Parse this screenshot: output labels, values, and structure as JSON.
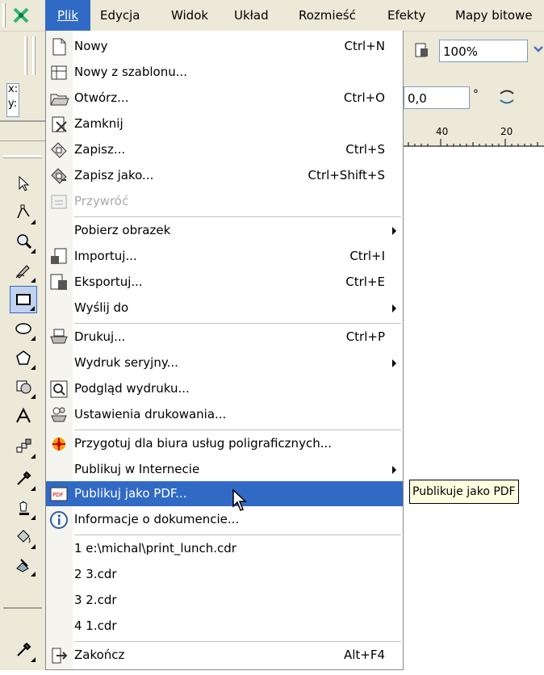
{
  "menubar": {
    "items": [
      {
        "label": "Plik",
        "active": true
      },
      {
        "label": "Edycja"
      },
      {
        "label": "Widok"
      },
      {
        "label": "Układ"
      },
      {
        "label": "Rozmieść"
      },
      {
        "label": "Efekty"
      },
      {
        "label": "Mapy bitowe"
      }
    ]
  },
  "toolbar": {
    "zoom_value": "100%",
    "x_label": "x:",
    "y_label": "y:",
    "angle_value": "0,0",
    "degree_symbol": "°"
  },
  "ruler": {
    "ticks": [
      "40",
      "20"
    ]
  },
  "file_menu": {
    "items": [
      {
        "label": "Nowy",
        "shortcut": "Ctrl+N",
        "icon": "new-document-icon"
      },
      {
        "label": "Nowy z szablonu...",
        "icon": "new-from-template-icon"
      },
      {
        "label": "Otwórz...",
        "shortcut": "Ctrl+O",
        "icon": "open-folder-icon"
      },
      {
        "label": "Zamknij",
        "icon": "close-document-icon"
      },
      {
        "label": "Zapisz...",
        "shortcut": "Ctrl+S",
        "icon": "save-icon"
      },
      {
        "label": "Zapisz jako...",
        "shortcut": "Ctrl+Shift+S",
        "icon": "save-as-icon"
      },
      {
        "label": "Przywróć",
        "disabled": true,
        "icon": "revert-icon"
      },
      {
        "label": "Pobierz obrazek",
        "submenu": true
      },
      {
        "label": "Importuj...",
        "shortcut": "Ctrl+I",
        "icon": "import-icon"
      },
      {
        "label": "Eksportuj...",
        "shortcut": "Ctrl+E",
        "icon": "export-icon"
      },
      {
        "label": "Wyślij do",
        "submenu": true
      },
      {
        "label": "Drukuj...",
        "shortcut": "Ctrl+P",
        "icon": "print-icon"
      },
      {
        "label": "Wydruk seryjny...",
        "submenu": true
      },
      {
        "label": "Podgląd wydruku...",
        "icon": "print-preview-icon"
      },
      {
        "label": "Ustawienia drukowania...",
        "icon": "print-setup-icon"
      },
      {
        "label": "Przygotuj dla biura usług poligraficznych...",
        "icon": "prepress-icon"
      },
      {
        "label": "Publikuj w Internecie",
        "submenu": true
      },
      {
        "label": "Publikuj jako PDF...",
        "highlighted": true,
        "icon": "pdf-icon"
      },
      {
        "label": "Informacje o dokumencie...",
        "icon": "info-icon"
      },
      {
        "label": "1 e:\\michal\\print_lunch.cdr"
      },
      {
        "label": "2 3.cdr"
      },
      {
        "label": "3 2.cdr"
      },
      {
        "label": "4 1.cdr"
      },
      {
        "label": "Zakończ",
        "shortcut": "Alt+F4",
        "icon": "exit-icon"
      }
    ]
  },
  "tooltip": {
    "text": "Publikuje jako PDF"
  },
  "colors": {
    "highlight": "#316ac5",
    "menu_bg": "#ffffff",
    "chrome": "#ece9d8",
    "tooltip_bg": "#ffffe1"
  }
}
